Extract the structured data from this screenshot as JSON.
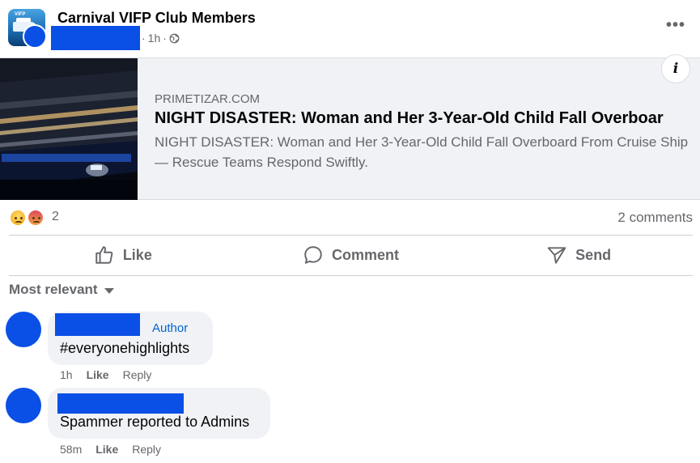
{
  "post": {
    "group_name": "Carnival VIFP Club Members",
    "time": "1h",
    "separator": "·",
    "privacy_icon": "globe-icon",
    "more_icon": "more-options-icon",
    "more_label": "•••"
  },
  "link_card": {
    "domain": "PRIMETIZAR.COM",
    "title": "NIGHT DISASTER: Woman and Her 3-Year-Old Child Fall Overboar",
    "description": "NIGHT DISASTER: Woman and Her 3-Year-Old Child Fall Overboard From Cruise Ship — Rescue Teams Respond Swiftly.",
    "info_label": "i"
  },
  "reactions": {
    "icons": [
      "sad-reaction-icon",
      "angry-reaction-icon"
    ],
    "count": "2",
    "comments_count": "2 comments"
  },
  "actions": {
    "like": "Like",
    "comment": "Comment",
    "send": "Send"
  },
  "sort": {
    "label": "Most relevant"
  },
  "comments": [
    {
      "author_tag": "Author",
      "text": "#everyonehighlights",
      "time": "1h",
      "like": "Like",
      "reply": "Reply"
    },
    {
      "text": "Spammer reported to Admins",
      "time": "58m",
      "like": "Like",
      "reply": "Reply"
    }
  ],
  "colors": {
    "accent_blue": "#0064d1",
    "redaction": "#0a4fe6",
    "secondary_text": "#65676b",
    "bubble_bg": "#f0f2f5"
  }
}
